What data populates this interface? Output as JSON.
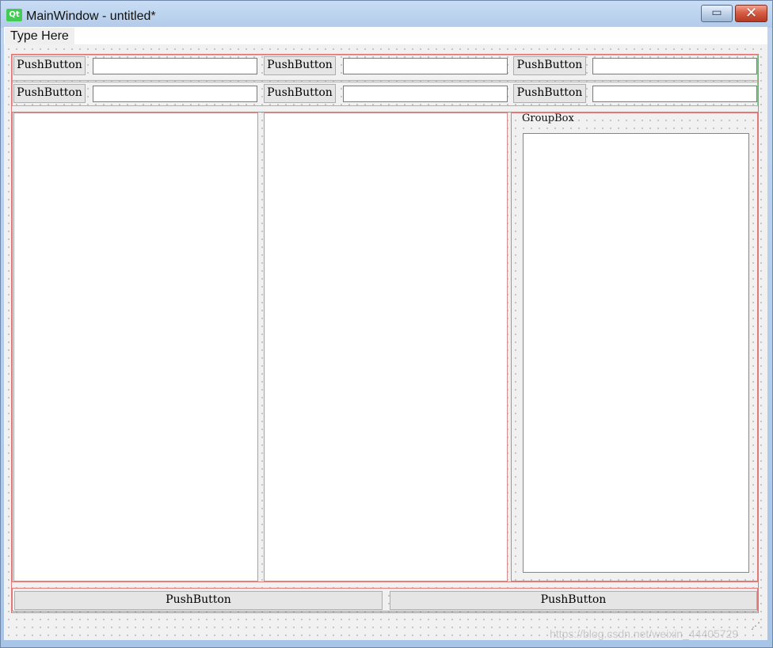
{
  "window": {
    "title": "MainWindow - untitled*",
    "logo_text": "Qt",
    "minimize_icon": "▭",
    "close_icon": "✕"
  },
  "menu": {
    "item": "Type Here"
  },
  "grid": {
    "row1": {
      "button1": "PushButton",
      "button2": "PushButton",
      "button3": "PushButton",
      "input1": "",
      "input2": "",
      "input3": ""
    },
    "row2": {
      "button1": "PushButton",
      "button2": "PushButton",
      "button3": "PushButton",
      "input1": "",
      "input2": "",
      "input3": ""
    }
  },
  "groupbox": {
    "title": "GroupBox"
  },
  "bottom": {
    "left_button": "PushButton",
    "right_button": "PushButton"
  },
  "watermark": {
    "text": "https://blog.csdn.net/weixin_44405729"
  },
  "colors": {
    "title_bar": "#b2cbe9",
    "close_button": "#d75d44",
    "layout_border": "#e27777",
    "client_background": "#f1f1f1",
    "qt_logo": "#41cd52"
  }
}
